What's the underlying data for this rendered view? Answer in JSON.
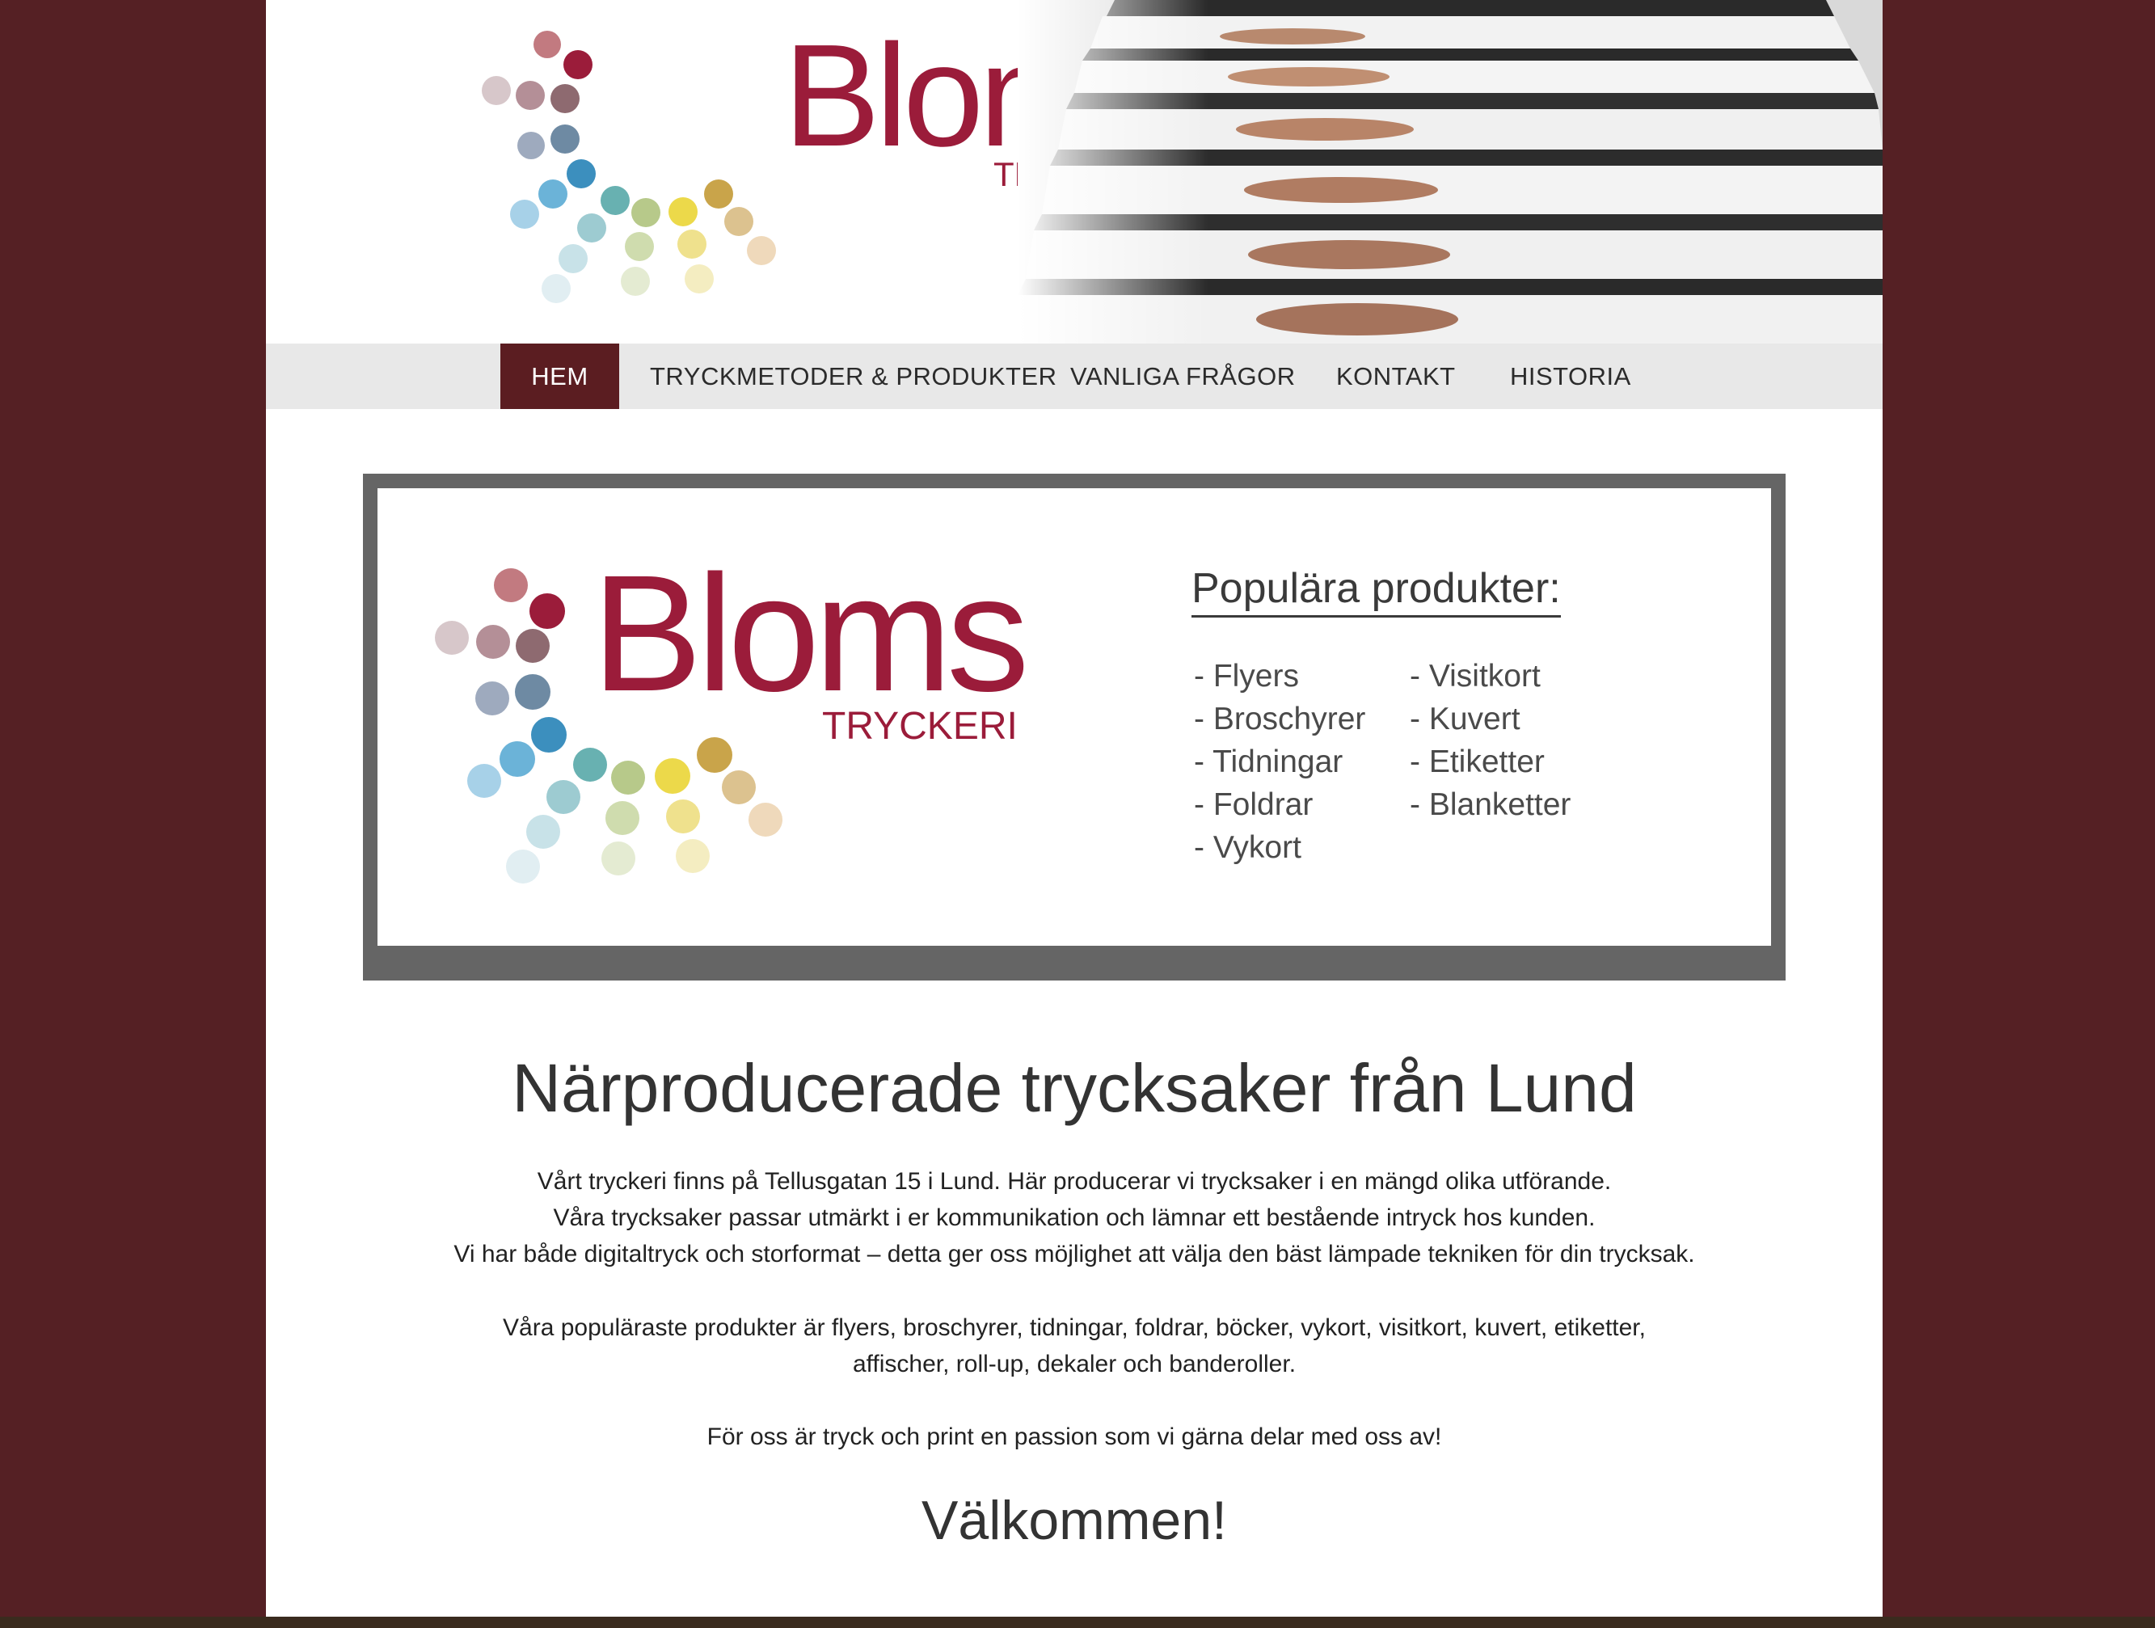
{
  "brand": {
    "name": "Bloms",
    "subtitle": "TRYCKERI",
    "color_primary": "#9b1c3a",
    "color_dark": "#5b1d21",
    "color_background": "#552024"
  },
  "nav": {
    "items": [
      {
        "label": "HEM",
        "active": true
      },
      {
        "label": "TRYCKMETODER & PRODUKTER",
        "active": false
      },
      {
        "label": "VANLIGA FRÅGOR",
        "active": false
      },
      {
        "label": "KONTAKT",
        "active": false
      },
      {
        "label": "HISTORIA",
        "active": false
      }
    ]
  },
  "banner": {
    "title": "Populära produkter:",
    "col1": [
      "- Flyers",
      "- Broschyrer",
      "- Tidningar",
      "- Foldrar",
      "- Vykort"
    ],
    "col2": [
      "- Visitkort",
      "- Kuvert",
      "- Etiketter",
      "- Blanketter"
    ]
  },
  "content": {
    "headline": "Närproducerade trycksaker från Lund",
    "paragraph1": [
      "Vårt tryckeri finns på Tellusgatan 15 i Lund. Här producerar vi trycksaker i en mängd olika utförande.",
      "Våra trycksaker passar utmärkt i er kommunikation och lämnar ett bestående intryck hos kunden.",
      "Vi har både digitaltryck och storformat – detta ger oss möjlighet att välja den bäst lämpade tekniken för din trycksak."
    ],
    "paragraph2": [
      "Våra populäraste produkter är flyers, broschyrer, tidningar, foldrar, böcker, vykort, visitkort, kuvert, etiketter,",
      "affischer, roll-up, dekaler och banderoller."
    ],
    "paragraph3": "För oss är tryck och print en passion som vi gärna delar med oss av!",
    "welcome": "Välkommen!"
  }
}
